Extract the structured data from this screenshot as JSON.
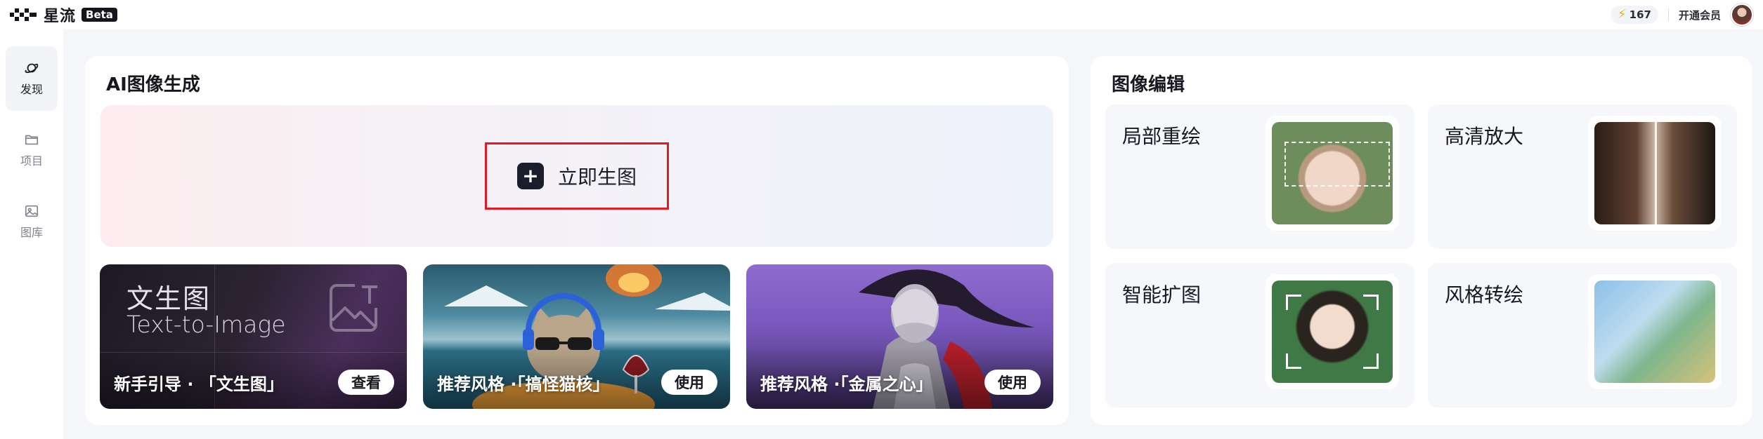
{
  "brand": {
    "name": "星流",
    "badge": "Beta"
  },
  "header": {
    "credits": "167",
    "vip_label": "开通会员"
  },
  "sidebar": {
    "items": [
      {
        "label": "发现",
        "icon": "planet-icon",
        "active": true
      },
      {
        "label": "项目",
        "icon": "folder-icon",
        "active": false
      },
      {
        "label": "图库",
        "icon": "image-icon",
        "active": false
      }
    ]
  },
  "generation": {
    "title": "AI图像生成",
    "create_label": "立即生图",
    "cards": [
      {
        "caption": "新手引导 · 「文生图」",
        "action": "查看",
        "headline_cn": "文生图",
        "headline_en": "Text-to-Image"
      },
      {
        "caption": "推荐风格 ·「搞怪猫核」",
        "action": "使用"
      },
      {
        "caption": "推荐风格 ·「金属之心」",
        "action": "使用"
      }
    ]
  },
  "editing": {
    "title": "图像编辑",
    "tools": [
      {
        "label": "局部重绘"
      },
      {
        "label": "高清放大"
      },
      {
        "label": "智能扩图"
      },
      {
        "label": "风格转绘"
      }
    ]
  },
  "colors": {
    "accent_dark": "#1a1d2b",
    "highlight_border": "#e01b24",
    "bolt": "#f5b500"
  }
}
